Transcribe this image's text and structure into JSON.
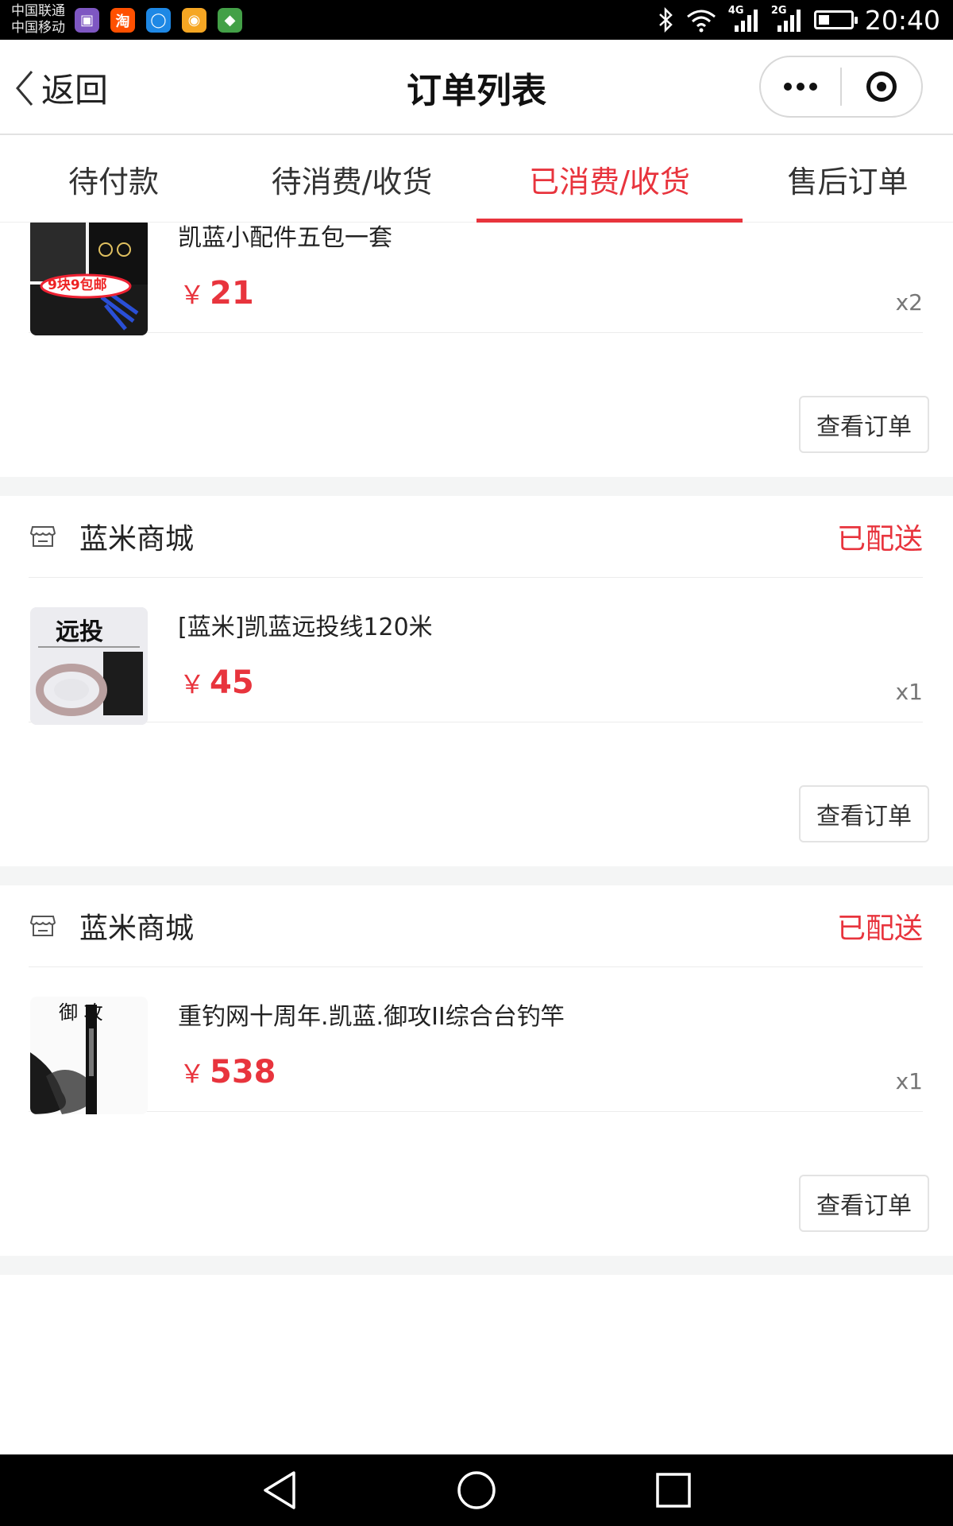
{
  "status_bar": {
    "carrier_1": "中国联通",
    "carrier_2": "中国移动",
    "net_1": "4G",
    "net_2": "2G",
    "time": "20:40",
    "battery_level": 0.35,
    "app_icons": [
      {
        "name": "gallery-app-icon",
        "color": "#7e57c2",
        "glyph": "▣"
      },
      {
        "name": "taobao-app-icon",
        "color": "#ff5000",
        "glyph": "淘"
      },
      {
        "name": "browser-app-icon",
        "color": "#1e88e5",
        "glyph": "◯"
      },
      {
        "name": "shop-app-icon",
        "color": "#f5a623",
        "glyph": "◉"
      },
      {
        "name": "security-app-icon",
        "color": "#43a047",
        "glyph": "◆"
      }
    ]
  },
  "nav": {
    "back_label": "返回",
    "title": "订单列表"
  },
  "tabs": [
    {
      "label": "待付款",
      "active": false
    },
    {
      "label": "待消费/收货",
      "active": false
    },
    {
      "label": "已消费/收货",
      "active": true
    },
    {
      "label": "售后订单",
      "active": false
    }
  ],
  "orders": [
    {
      "shop": "",
      "status": "",
      "product": {
        "name": "凯蓝小配件五包一套",
        "price_symbol": "￥",
        "price": "21",
        "qty": "x2"
      },
      "button": "查看订单",
      "thumb_text": "9块9包邮"
    },
    {
      "shop": "蓝米商城",
      "status": "已配送",
      "product": {
        "name": "[蓝米]凯蓝远投线120米",
        "price_symbol": "￥",
        "price": "45",
        "qty": "x1"
      },
      "button": "查看订单",
      "thumb_text": "远投"
    },
    {
      "shop": "蓝米商城",
      "status": "已配送",
      "product": {
        "name": "重钓网十周年.凯蓝.御攻II综合台钓竿",
        "price_symbol": "￥",
        "price": "538",
        "qty": "x1"
      },
      "button": "查看订单",
      "thumb_text": "御 攻"
    }
  ],
  "colors": {
    "accent": "#e8343d",
    "divider": "#ececec",
    "gap": "#f4f5f5"
  }
}
